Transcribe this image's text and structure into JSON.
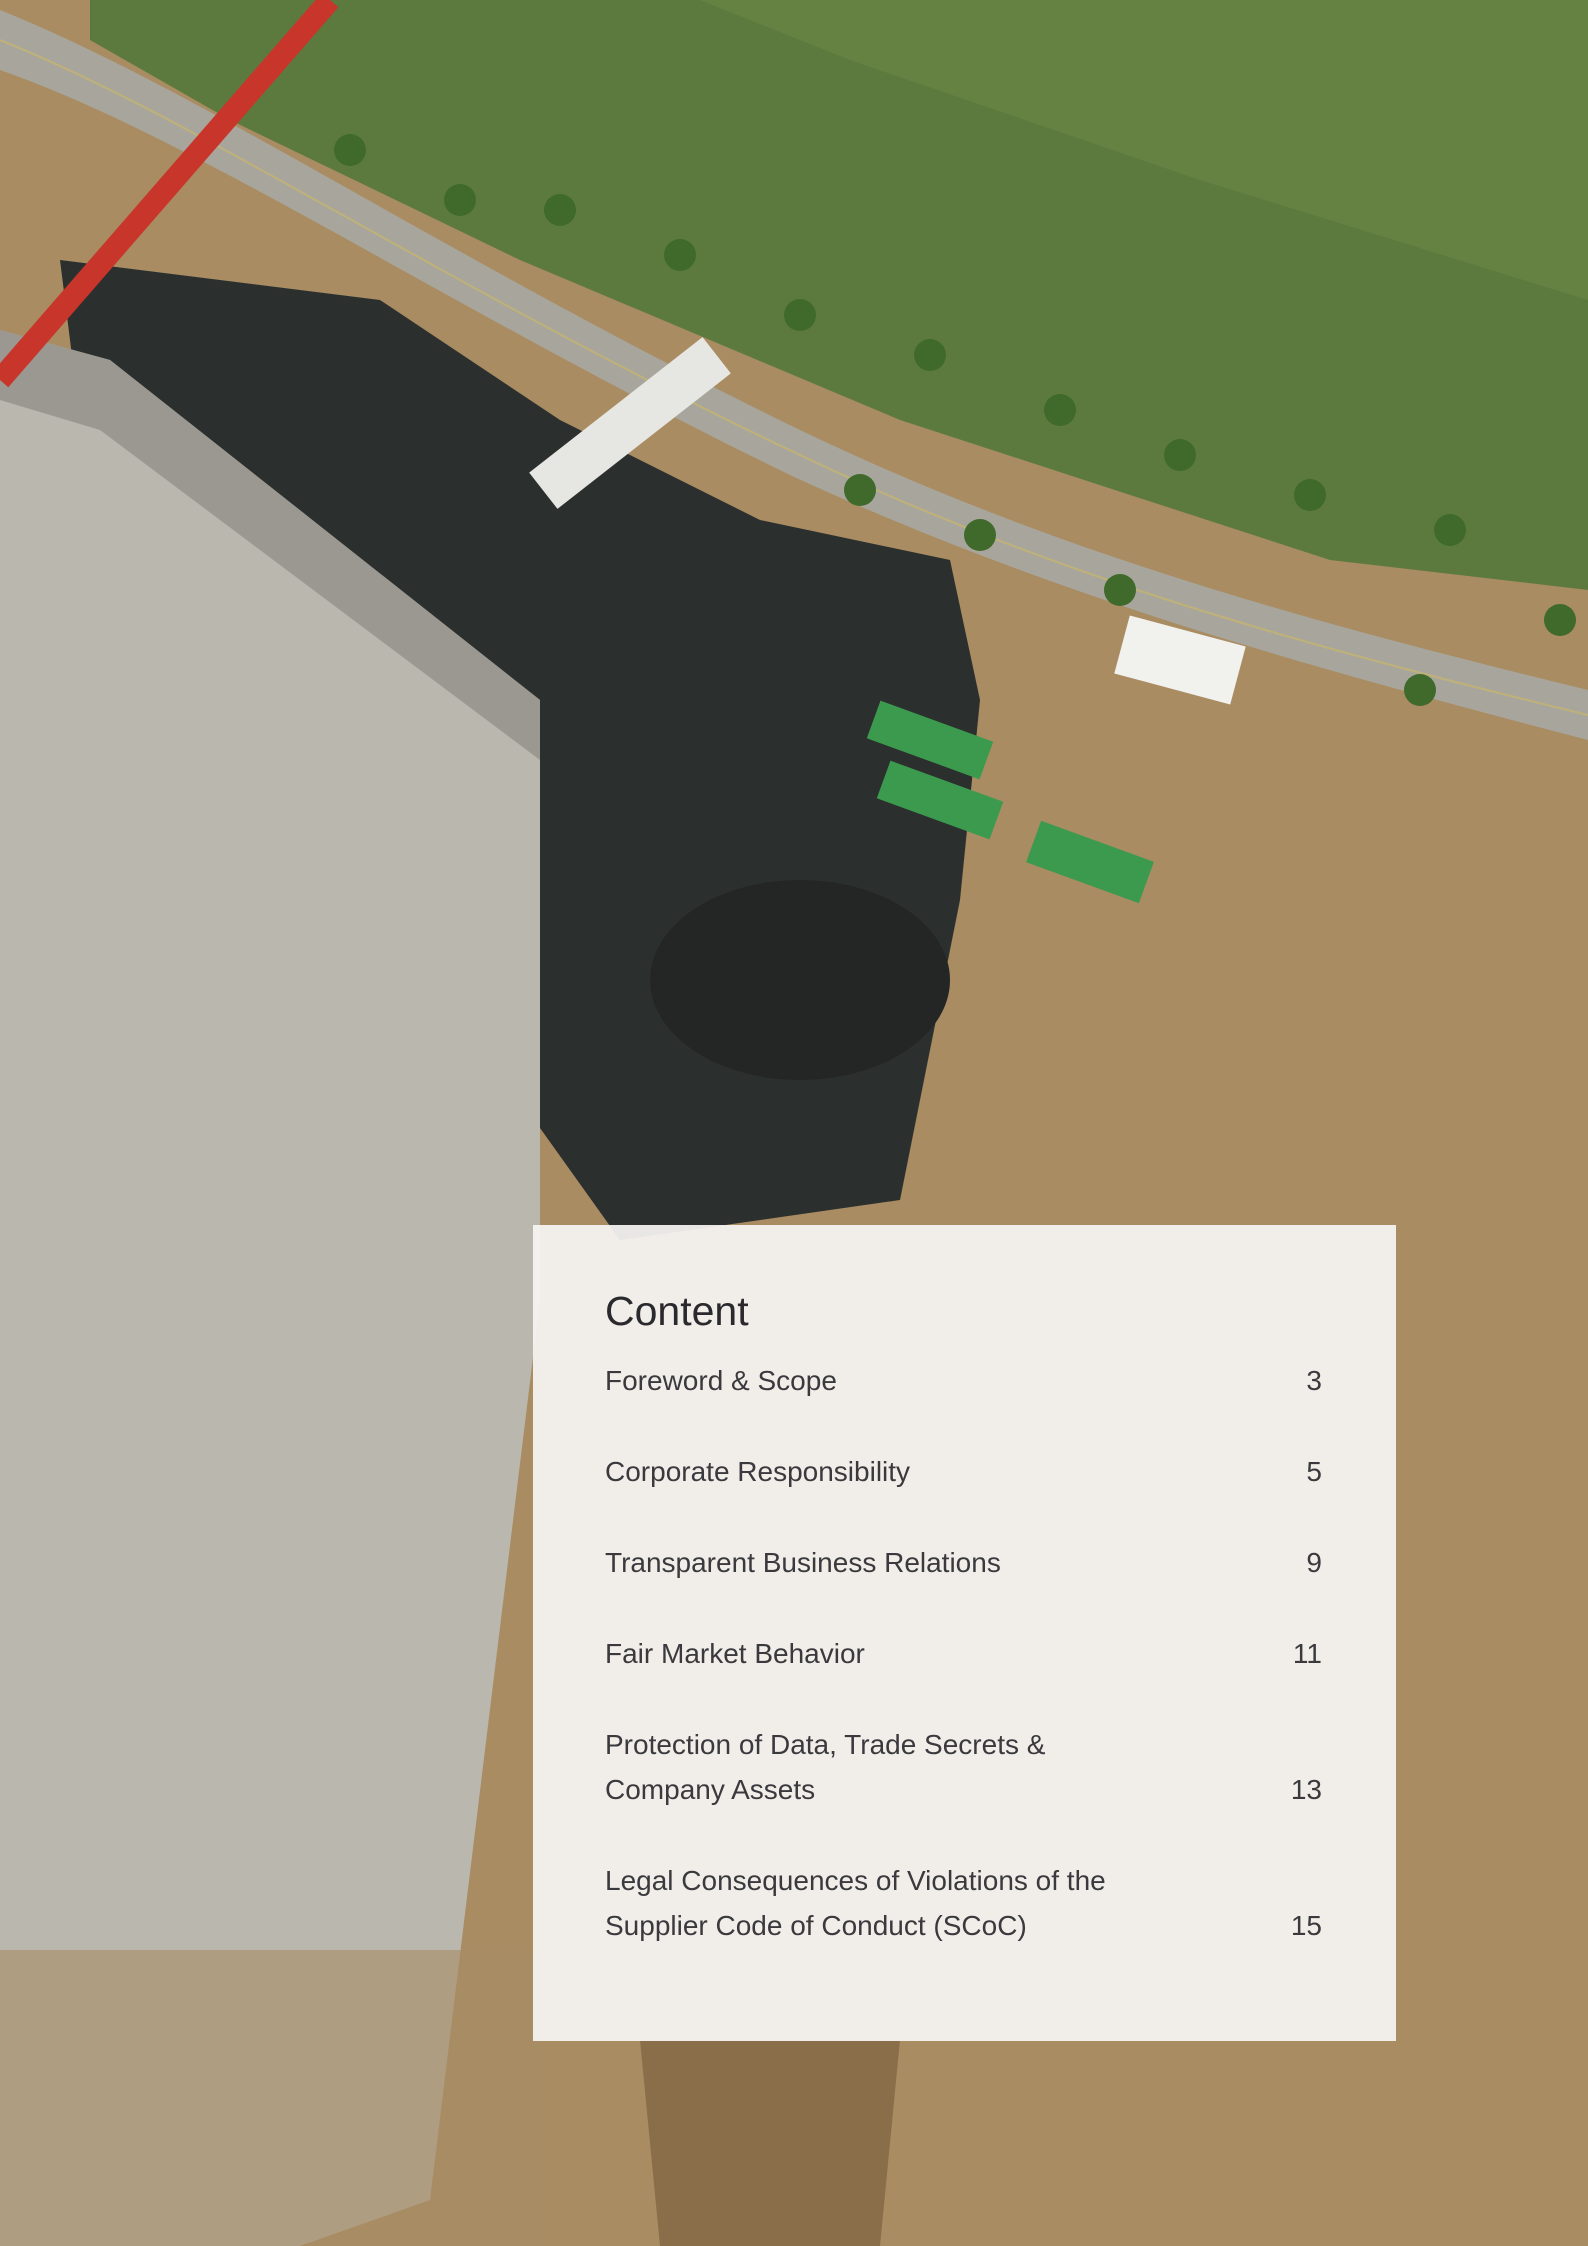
{
  "toc": {
    "title": "Content",
    "items": [
      {
        "label": "Foreword & Scope",
        "page": "3"
      },
      {
        "label": "Corporate Responsibility",
        "page": "5"
      },
      {
        "label": "Transparent Business Relations",
        "page": "9"
      },
      {
        "label": "Fair Market Behavior",
        "page": "11"
      },
      {
        "label": "Protection of Data, Trade Secrets & Company Assets",
        "page": "13"
      },
      {
        "label": "Legal Consequences of Violations of the Supplier Code of Conduct (SCoC)",
        "page": "15"
      }
    ]
  },
  "colors": {
    "panel": "#f6f5f3",
    "text": "#3a3a3e",
    "grass": "#5d7a3e",
    "road": "#a8a69c",
    "concrete": "#b9b7ae",
    "dirt": "#a98c62",
    "shadow": "#2b2f2e",
    "crane": "#c8352b"
  }
}
